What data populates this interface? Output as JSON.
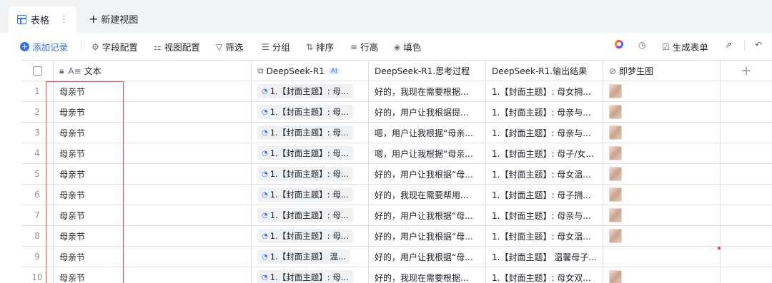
{
  "tabs": {
    "active_label": "表格",
    "more": "⋮",
    "new_view_label": "新建视图"
  },
  "toolbar": {
    "add_record": "添加记录",
    "field_config": "字段配置",
    "view_config": "视图配置",
    "filter": "筛选",
    "group": "分组",
    "sort": "排序",
    "row_height": "行高",
    "fill_color": "填色",
    "generate_form": "生成表单"
  },
  "table": {
    "columns": [
      {
        "label": "文本",
        "icon": "text-field-icon"
      },
      {
        "label": "DeepSeek-R1",
        "badge": "AI",
        "icon": "ai-field-icon"
      },
      {
        "label": "DeepSeek-R1.思考过程"
      },
      {
        "label": "DeepSeek-R1.输出结果"
      },
      {
        "label": "即梦生图",
        "icon": "attachment-icon"
      }
    ],
    "add_column": "+",
    "rows": [
      {
        "idx": "1",
        "text": "母亲节",
        "ai": "1.【封面主题】: 母...",
        "think": "好的，我现在需要根据...",
        "output": "1.【封面主题】: 母女拥...",
        "img": true
      },
      {
        "idx": "2",
        "text": "母亲节",
        "ai": "1.【封面主题】: 母...",
        "think": "好的，用户让我根据提...",
        "output": "1.【封面主题】: 母亲与...",
        "img": true
      },
      {
        "idx": "3",
        "text": "母亲节",
        "ai": "1.【封面主题】: 母...",
        "think": "嗯，用户让我根据“母亲...",
        "output": "1.【封面主题】: 母亲与...",
        "img": true
      },
      {
        "idx": "4",
        "text": "母亲节",
        "ai": "1.【封面主题】: 母...",
        "think": "嗯，用户让我根据“母亲...",
        "output": "1.【封面主题】: 母子/女...",
        "img": true
      },
      {
        "idx": "5",
        "text": "母亲节",
        "ai": "1.【封面主题】: 母...",
        "think": "好的，用户让我根据“母...",
        "output": "1.【封面主题】: 母女温...",
        "img": true
      },
      {
        "idx": "6",
        "text": "母亲节",
        "ai": "1.【封面主题】: 母...",
        "think": "好的，我现在需要帮用...",
        "output": "1.【封面主题】: 母子拥...",
        "img": true
      },
      {
        "idx": "7",
        "text": "母亲节",
        "ai": "1.【封面主题】: 母...",
        "think": "好的，用户让我根据“母...",
        "output": "1.【封面主题】: 母亲与...",
        "img": true
      },
      {
        "idx": "8",
        "text": "母亲节",
        "ai": "1.【封面主题】: 母...",
        "think": "好的，用户让我根据“母...",
        "output": "1.【封面主题】: 母女温...",
        "img": true
      },
      {
        "idx": "9",
        "text": "母亲节",
        "ai": "1.【封面主题】 温...",
        "think": "好的，用户让我根据“母...",
        "output": "1.【封面主题】 温馨母子...",
        "img": false
      },
      {
        "idx": "10",
        "text": "母亲节",
        "ai": "1.【封面主题】: 母...",
        "think": "好的，我现在需要根据...",
        "output": "1.【封面主题】: 母女双...",
        "img": true
      }
    ]
  },
  "colors": {
    "accent": "#3370ff",
    "highlight": "#f54a45"
  }
}
